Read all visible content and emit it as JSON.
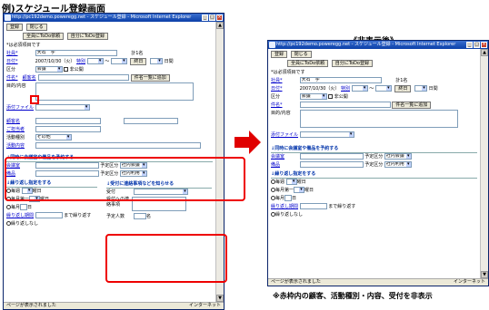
{
  "heading": "例)スケジュール登録画面",
  "after_heading": "《非表示後》",
  "footnote": "※赤枠内の顧客、活動種別・内容、受付を非表示",
  "window": {
    "title": "http://pc192demo.poweregg.net - スケジュール登録 - Microsoft Internet Explorer",
    "status": "ページが表示されました",
    "zone": "インターネット"
  },
  "buttons": {
    "register": "登録",
    "close": "閉じる",
    "todo_all": "全員にToDo依頼",
    "todo_self": "自分にToDo登録",
    "add_from_list": "件名一覧に追加"
  },
  "form": {
    "required_note": "*は必須項目です",
    "participants_label": "社員*",
    "participant_value": "大石　学",
    "count": "計1名",
    "date_label": "日付*",
    "date_value": "2007/10/30（火）",
    "specific": "特別",
    "tilde": "～",
    "end_day": "終日",
    "day_suffix": "日間",
    "category_label": "区分",
    "category_value": "会議",
    "private_label": "非公開",
    "subject_label": "件名*",
    "customer_label": "顧客名",
    "memo_label": "目的/内容",
    "attachment_label": "添付ファイル",
    "guest_label": "ご担当者",
    "activity_type_label": "活動種別",
    "activity_type_value": "その他",
    "activity_content_label": "活動内容",
    "meeting_section": "同時に会議室や備品を予約する",
    "meeting_room_label": "会議室",
    "equipment_label": "備品",
    "schedule_class": "予定区分",
    "room_value": "社内会議",
    "equip_value": "社内利用",
    "repeat_section": "繰り返し指定をする",
    "weekly": "毎週",
    "monthly_nth": "毎月第一",
    "monthly_day": "毎月",
    "month_unit": "月",
    "weekday": "曜日",
    "day_unit": "日",
    "repeat_period": "繰り返し期間",
    "until_repeat": "まで繰り返す",
    "no_repeat": "繰り返しなし",
    "reception_section": "受付に連絡事項などを知らせる",
    "reception_label": "受付",
    "reception_notes": "受付への連絡事項",
    "planned_people": "予定人数",
    "people_unit": "名",
    "weekly_month": "月",
    "nth_value": "1"
  }
}
